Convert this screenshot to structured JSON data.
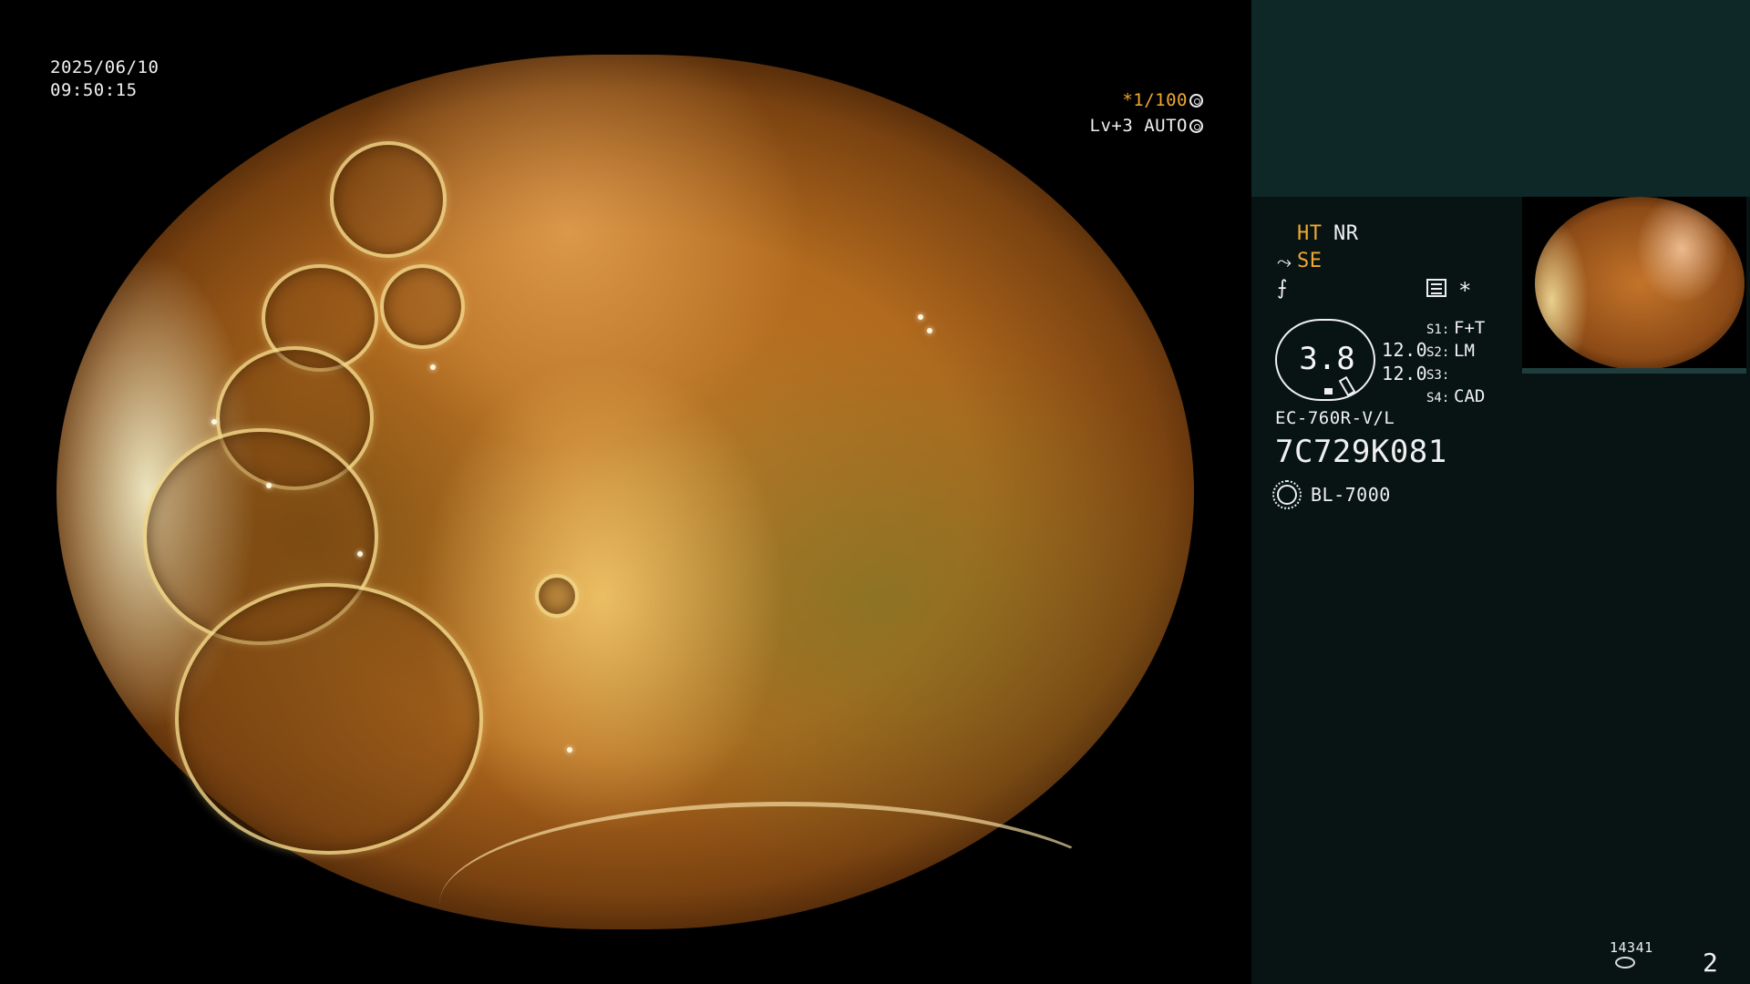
{
  "video": {
    "date": "2025/06/10",
    "time": "09:50:15",
    "shutter": "*1/100",
    "shutter_icon": "aperture-icon",
    "level": "Lv+3 AUTO",
    "level_icon": "iris-icon"
  },
  "panel": {
    "modes": {
      "ht": "HT",
      "nr": "NR",
      "se": "SE"
    },
    "icons": [
      "structure-enhance-icon",
      "freeze-icon",
      "grid-icon",
      "asterisk-icon"
    ],
    "asterisk": "*",
    "gauge_value": "3.8",
    "values": [
      "12.0",
      "12.0"
    ],
    "switches": [
      {
        "label": "S1:",
        "value": "F+T"
      },
      {
        "label": "S2:",
        "value": "LM"
      },
      {
        "label": "S3:",
        "value": ""
      },
      {
        "label": "S4:",
        "value": "CAD"
      }
    ],
    "scope_model": "EC-760R-V/L",
    "scope_serial": "7C729K081",
    "light_source": "BL-7000",
    "storage_count": "14341",
    "page_number": "2"
  },
  "colors": {
    "accent_orange": "#f0a832",
    "panel_bg": "#081414",
    "panel_top_bg": "#0e2727"
  }
}
